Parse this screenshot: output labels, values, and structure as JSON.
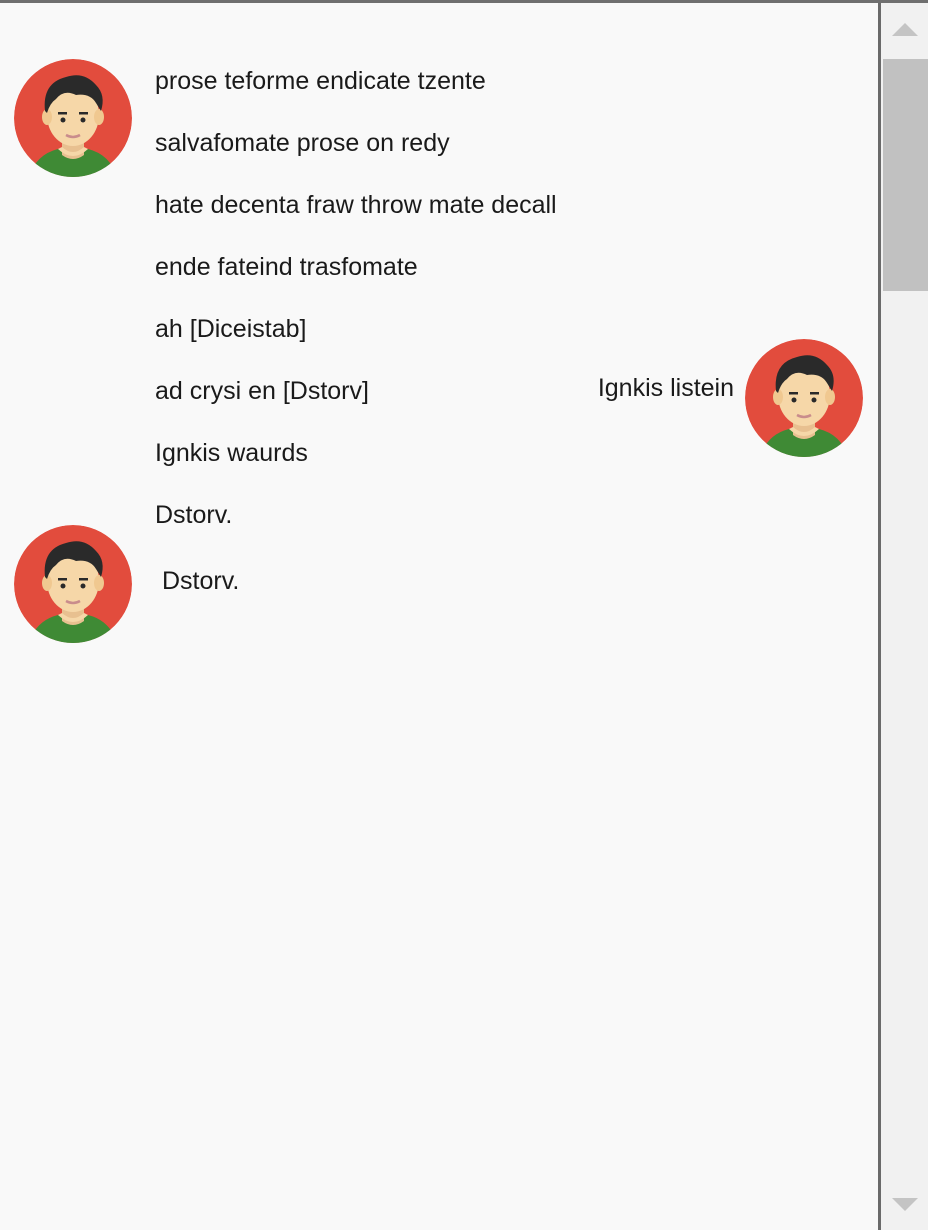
{
  "messages": [
    {
      "side": "left",
      "lines": [
        "prose teforme endicate tzente",
        "salvafomate prose on redy",
        "hate decenta fraw throw mate decall",
        "ende fateind trasfomate",
        "ah [Diceistab]",
        "ad crysi en [Dstorv]",
        "Ignkis waurds",
        "Dstorv."
      ]
    },
    {
      "side": "right",
      "lines": [
        "Ignkis listein"
      ]
    },
    {
      "side": "left",
      "lines": [
        "Dstorv."
      ]
    }
  ],
  "icons": {
    "avatar": "user-avatar-icon",
    "scroll_up": "scroll-up-arrow-icon",
    "scroll_down": "scroll-down-arrow-icon"
  },
  "colors": {
    "background": "#f9f9f9",
    "avatar_bg": "#e24c3d",
    "avatar_shirt": "#3f8a35",
    "avatar_hair": "#2a2a2a",
    "avatar_skin": "#f6d7a8",
    "scrollbar_thumb": "#c1c1c1",
    "scrollbar_track": "#f1f1f1"
  }
}
